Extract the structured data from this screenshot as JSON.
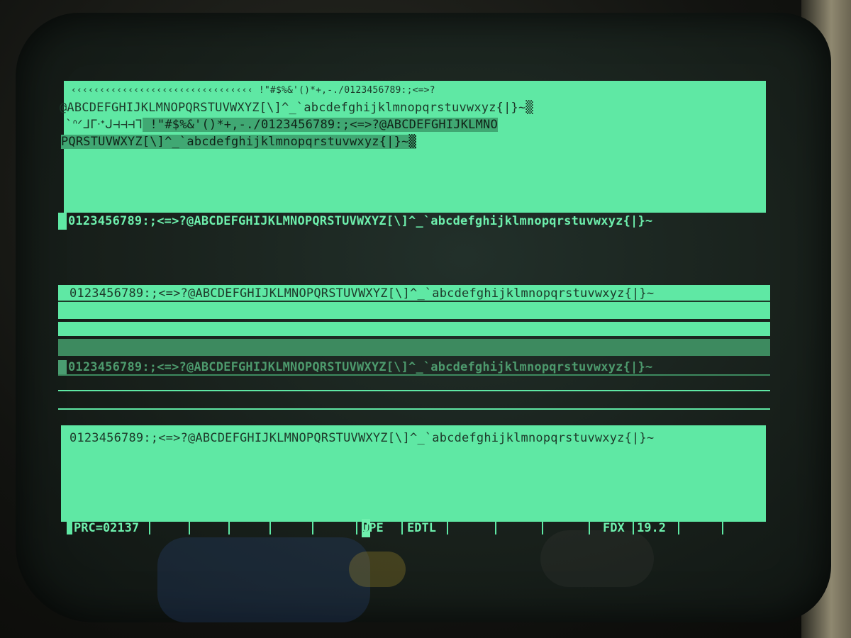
{
  "screen": {
    "block1": {
      "line1": "‹‹‹‹‹‹‹‹‹‹‹‹‹‹‹‹‹‹‹‹‹‹‹‹‹‹‹‹‹‹‹‹ !\"#$%&'()*+,-./0123456789:;<=>?",
      "line2": "@ABCDEFGHIJKLMNOPQRSTUVWXYZ[\\]^_`abcdefghijklmnopqrstuvwxyz{|}~▒",
      "line3_graphics": "`ᐢᐟᒧᒥᐧᐩᒍ⊣⊣⊣ᒣ",
      "line3_text": " !\"#$%&'()*+,-./0123456789:;<=>?@ABCDEFGHIJKLMNO",
      "line4": "PQRSTUVWXYZ[\\]^_`abcdefghijklmnopqrstuvwxyz{|}~▒"
    },
    "row_normal": "0123456789:;<=>?@ABCDEFGHIJKLMNOPQRSTUVWXYZ[\\]^_`abcdefghijklmnopqrstuvwxyz{|}~",
    "row_underline": "0123456789:;<=>?@ABCDEFGHIJKLMNOPQRSTUVWXYZ[\\]^_`abcdefghijklmnopqrstuvwxyz{|}~",
    "row_dim": "0123456789:;<=>?@ABCDEFGHIJKLMNOPQRSTUVWXYZ[\\]^_`abcdefghijklmnopqrstuvwxyz{|}~",
    "row_reverse_blink": "0123456789:;<=>?@ABCDEFGHIJKLMNOPQRSTUVWXYZ[\\]^_`abcdefghijklmnopqrstuvwxyz{|}~"
  },
  "status_bar": {
    "prc": "PRC=02137",
    "dupe_first": "D",
    "dupe_rest": "UPE",
    "editor": "EDTL",
    "fdx": "FDX",
    "baud": "19.2"
  },
  "colors": {
    "phosphor": "#5fe8a4",
    "phosphor_dim": "#3d8a5f",
    "background": "#18201b"
  }
}
